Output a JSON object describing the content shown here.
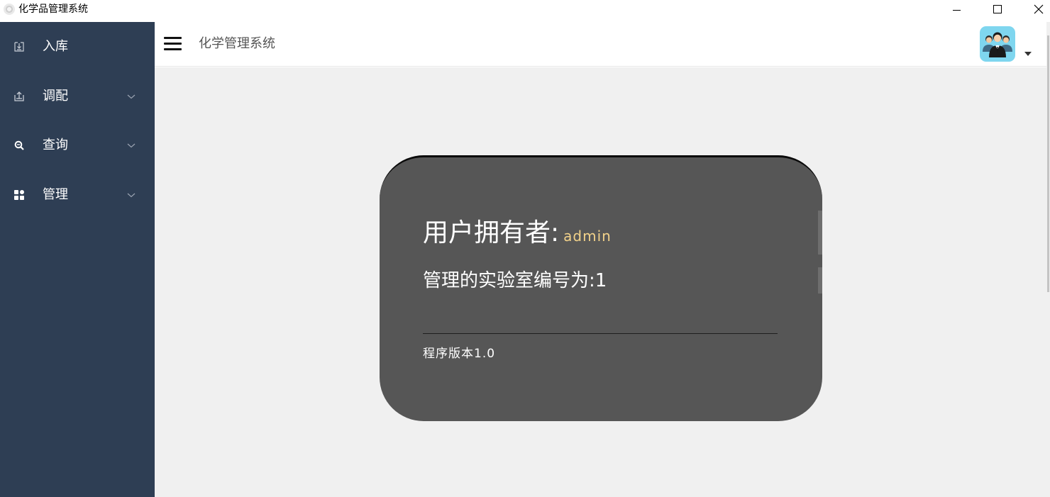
{
  "window": {
    "title": "化学品管理系统",
    "app_icon": "app-disc-icon",
    "controls": [
      "minimize-icon",
      "maximize-icon",
      "close-icon"
    ]
  },
  "sidebar": {
    "background": "#2e3e54",
    "items": [
      {
        "label": "入库",
        "icon": "import-icon",
        "has_submenu": false
      },
      {
        "label": "调配",
        "icon": "export-icon",
        "has_submenu": true
      },
      {
        "label": "查询",
        "icon": "search-icon",
        "has_submenu": true
      },
      {
        "label": "管理",
        "icon": "grid-icon",
        "has_submenu": true
      }
    ]
  },
  "header": {
    "menu_toggle_icon": "hamburger-icon",
    "title": "化学管理系统",
    "avatar_icon": "users-avatar-icon",
    "dropdown_icon": "caret-down-icon"
  },
  "card": {
    "owner_label": "用户拥有者:",
    "owner_value": "admin",
    "lab_text": "管理的实验室编号为:1",
    "version_text": "程序版本1.0",
    "background": "#565656",
    "accent": "#f2d28a"
  }
}
